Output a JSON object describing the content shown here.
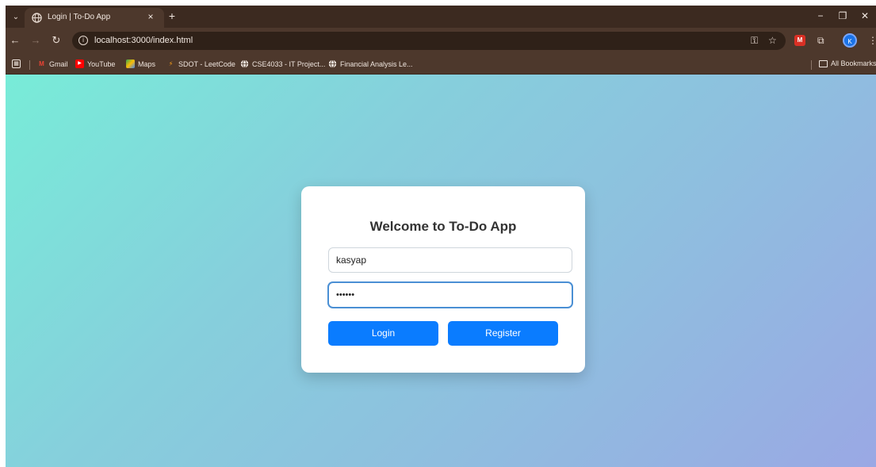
{
  "browser": {
    "tab": {
      "title": "Login | To-Do App",
      "close": "×"
    },
    "new_tab": "+",
    "window_controls": {
      "minimize": "−",
      "restore": "❐",
      "close": "✕"
    },
    "url": "localhost:3000/index.html",
    "bookmarks": [
      {
        "label": "Gmail",
        "icon": "gmail-icon"
      },
      {
        "label": "YouTube",
        "icon": "youtube-icon"
      },
      {
        "label": "Maps",
        "icon": "maps-icon"
      },
      {
        "label": "SDOT - LeetCode",
        "icon": "leetcode-icon"
      },
      {
        "label": "CSE4033 - IT Project...",
        "icon": "globe-icon"
      },
      {
        "label": "Financial Analysis Le...",
        "icon": "globe-icon"
      }
    ],
    "all_bookmarks": "All Bookmarks",
    "avatar_initial": "K"
  },
  "login": {
    "title": "Welcome to To-Do App",
    "username_value": "kasyap",
    "password_value": "••••••",
    "login_label": "Login",
    "register_label": "Register"
  },
  "colors": {
    "button": "#0a7cff",
    "chrome_frame": "#3c2a20",
    "gradient_start": "#78ecd8",
    "gradient_end": "#9aa8e4"
  }
}
